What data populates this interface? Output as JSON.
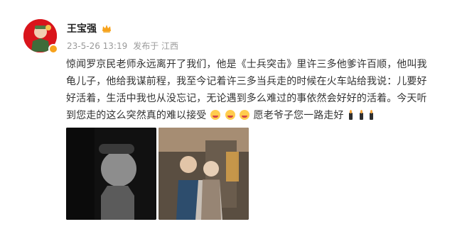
{
  "post": {
    "author": "王宝强",
    "timestamp": "23-5-26 13:19",
    "source": "发布于 江西",
    "content": [
      "惊闻罗京民老师永远离开了我们，他是《士兵突击》里许三多他爹许百顺，他叫我",
      "龟儿子，他给我谋前程，我至今记着许三多当兵走的时候在火车站给我说：儿要好",
      "好活着，生活中我也从没忘记，无论遇到多么难过的事依然会好好的活着。今天听",
      "到您走的这么突然真的难以接受"
    ],
    "content_tail": "愿老爷子您一路走好",
    "icons": [
      "avatar-icon",
      "crown-icon",
      "crying-face-icon",
      "candle-icon"
    ]
  },
  "colors": {
    "name": "#222222",
    "meta": "#9a9a9a",
    "text": "#333333",
    "accent": "#f7a21b",
    "avatarBg": "#d9141b"
  }
}
